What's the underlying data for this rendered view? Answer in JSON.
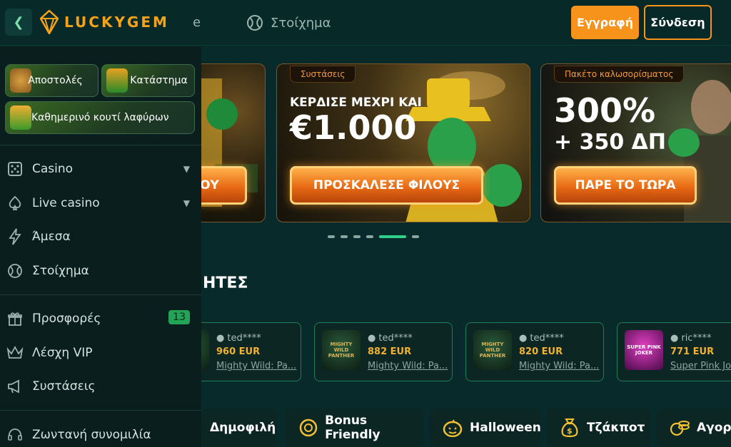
{
  "header": {
    "logo_text": "LUCKYGEM",
    "ghost_text": "e",
    "nav_sports": "Στοίχημα",
    "register_label": "Εγγραφή",
    "login_label": "Σύνδεση"
  },
  "sidebar": {
    "promos": [
      {
        "label": "Αποστολές"
      },
      {
        "label": "Κατάστημα"
      },
      {
        "label": "Καθημερινό κουτί λαφύρων"
      }
    ],
    "games": [
      {
        "label": "Casino"
      },
      {
        "label": "Live casino"
      },
      {
        "label": "Άμεσα"
      },
      {
        "label": "Στοίχημα"
      }
    ],
    "extras": [
      {
        "label": "Προσφορές",
        "badge": "13"
      },
      {
        "label": "Λέσχη VIP"
      },
      {
        "label": "Συστάσεις"
      }
    ],
    "chat_label": "Ζωντανή συνομιλία"
  },
  "banners": [
    {
      "button": "ΟΥ"
    },
    {
      "tag": "Συστάσεις",
      "title_small": "ΚΕΡΔΙΣΕ ΜΕΧΡΙ ΚΑΙ",
      "title_big": "€1.000",
      "button": "ΠΡΟΣΚΑΛΕΣΕ ΦΙΛΟΥΣ"
    },
    {
      "tag": "Πακέτο καλωσορίσματος",
      "title_big": "300%",
      "title_line2": "+ 350 ΔΠ",
      "button": "ΠΑΡΕ ΤΟ ΤΩΡΑ"
    }
  ],
  "section_title": "ΗΤΕΣ",
  "winners": [
    {
      "user": "ted****",
      "amount": "960 EUR",
      "game": "Mighty Wild: Pa...",
      "thumb": ""
    },
    {
      "user": "ted****",
      "amount": "882 EUR",
      "game": "Mighty Wild: Pa...",
      "thumb": "MIGHTY WILD PANTHER"
    },
    {
      "user": "ted****",
      "amount": "820 EUR",
      "game": "Mighty Wild: Pa...",
      "thumb": "MIGHTY WILD PANTHER"
    },
    {
      "user": "ric****",
      "amount": "771 EUR",
      "game": "Super Pink Jo",
      "thumb": "SUPER PINK JOKER"
    }
  ],
  "categories": [
    {
      "label": "Δημοφιλή"
    },
    {
      "label": "Bonus Friendly"
    },
    {
      "label": "Halloween"
    },
    {
      "label": "Τζάκποτ"
    },
    {
      "label": "Αγορ"
    }
  ],
  "colors": {
    "accent": "#f7931a",
    "green": "#2fd08a",
    "bg": "#082a2a"
  }
}
